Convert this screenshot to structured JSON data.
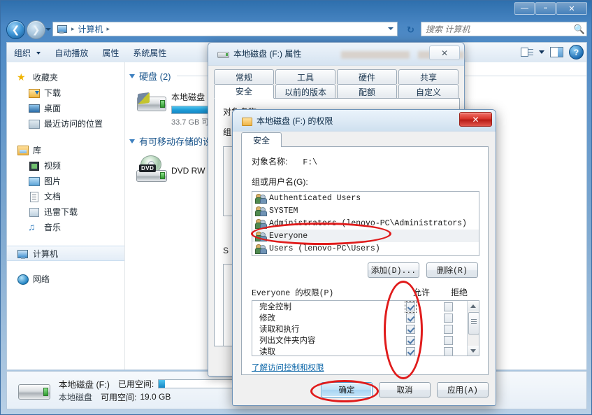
{
  "window": {
    "title": "计算机",
    "controls": {
      "minimize": "—",
      "maximize": "▫",
      "close": "✕"
    }
  },
  "address_bar": {
    "crumbs": [
      "计算机"
    ],
    "separator": "▸",
    "refresh_label": "↻"
  },
  "search": {
    "placeholder": "搜索 计算机",
    "icon": "search-icon"
  },
  "toolbar": {
    "items": [
      {
        "label": "组织",
        "has_caret": true
      },
      {
        "label": "自动播放",
        "has_caret": false
      },
      {
        "label": "属性",
        "has_caret": false
      },
      {
        "label": "系统属性",
        "has_caret": false
      }
    ]
  },
  "sidebar": {
    "groups": [
      {
        "header": {
          "label": "收藏夹",
          "icon": "star-icon"
        },
        "items": [
          {
            "label": "下载",
            "icon": "downloads-icon"
          },
          {
            "label": "桌面",
            "icon": "desktop-icon"
          },
          {
            "label": "最近访问的位置",
            "icon": "recent-places-icon"
          }
        ]
      },
      {
        "header": {
          "label": "库",
          "icon": "library-icon"
        },
        "items": [
          {
            "label": "视频",
            "icon": "video-icon"
          },
          {
            "label": "图片",
            "icon": "pictures-icon"
          },
          {
            "label": "文档",
            "icon": "documents-icon"
          },
          {
            "label": "迅雷下载",
            "icon": "thunder-download-icon"
          },
          {
            "label": "音乐",
            "icon": "music-icon"
          }
        ]
      },
      {
        "header": {
          "label": "计算机",
          "icon": "computer-icon",
          "selected": true
        },
        "items": []
      },
      {
        "header": {
          "label": "网络",
          "icon": "network-icon"
        },
        "items": []
      }
    ]
  },
  "content": {
    "groups": [
      {
        "title": "硬盘 (2)",
        "drives": [
          {
            "name": "本地磁盘 (",
            "icon": "hard-drive-icon",
            "free_text": "33.7 GB 可",
            "usage_percent": 64
          }
        ]
      },
      {
        "title": "有可移动存储的设",
        "drives": [
          {
            "name": "DVD RW 驱",
            "icon": "dvd-drive-icon",
            "badge": "DVD"
          }
        ]
      }
    ]
  },
  "details_bar": {
    "icon": "hard-drive-icon",
    "name": "本地磁盘 (F:)",
    "used_label": "已用空间:",
    "used_percent": 4,
    "type": "本地磁盘",
    "free_label": "可用空间:",
    "free_value": "19.0 GB"
  },
  "properties_dialog": {
    "title": "本地磁盘 (F:) 属性",
    "icon": "drive-icon",
    "close_label": "✕",
    "tabs_row1": [
      "常规",
      "工具",
      "硬件",
      "共享"
    ],
    "tabs_row2": [
      "安全",
      "以前的版本",
      "配额",
      "自定义"
    ],
    "active_tab": "安全"
  },
  "permissions_dialog": {
    "title": "本地磁盘 (F:) 的权限",
    "icon": "folder-icon",
    "close_label": "✕",
    "tab": "安全",
    "object_name_label": "对象名称:",
    "object_name_value": "F:\\",
    "group_label": "组或用户名(G):",
    "users": [
      {
        "name": "Authenticated Users",
        "selected": false
      },
      {
        "name": "SYSTEM",
        "selected": false
      },
      {
        "name": "Administrators (lenovo-PC\\Administrators)",
        "selected": false
      },
      {
        "name": "Everyone",
        "selected": true
      },
      {
        "name": "Users (lenovo-PC\\Users)",
        "selected": false
      }
    ],
    "add_button": "添加(D)...",
    "remove_button": "删除(R)",
    "permissions_header": "Everyone 的权限(P)",
    "allow_column": "允许",
    "deny_column": "拒绝",
    "permissions": [
      {
        "name": "完全控制",
        "allow": true,
        "deny": false,
        "focused": true
      },
      {
        "name": "修改",
        "allow": true,
        "deny": false,
        "focused": false
      },
      {
        "name": "读取和执行",
        "allow": true,
        "deny": false,
        "focused": false
      },
      {
        "name": "列出文件夹内容",
        "allow": true,
        "deny": false,
        "focused": false
      },
      {
        "name": "读取",
        "allow": true,
        "deny": false,
        "focused": false
      }
    ],
    "link": "了解访问控制和权限",
    "buttons": {
      "ok": "确定",
      "cancel": "取消",
      "apply": "应用(A)"
    }
  },
  "annotations": [
    {
      "name": "everyone-highlight",
      "target": "Everyone"
    },
    {
      "name": "allow-column-highlight",
      "target": "允许"
    },
    {
      "name": "ok-button-highlight",
      "target": "确定"
    }
  ]
}
